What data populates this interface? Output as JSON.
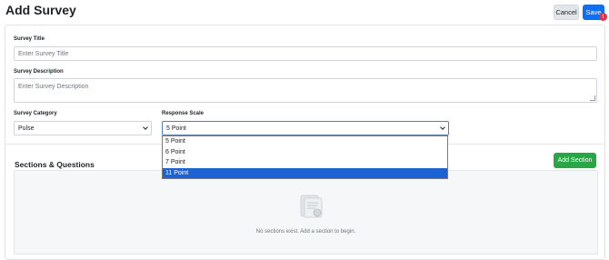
{
  "header": {
    "title": "Add Survey",
    "cancel_label": "Cancel",
    "save_label": "Save",
    "badge": "!"
  },
  "form": {
    "title_label": "Survey Title",
    "title_placeholder": "Enter Survey Title",
    "description_label": "Survey Description",
    "description_placeholder": "Enter Survey Description",
    "category_label": "Survey Category",
    "category_value": "Pulse",
    "scale_label": "Response Scale",
    "scale_value": "5 Point",
    "scale_options": [
      "5 Point",
      "6 Point",
      "7 Point",
      "11 Point"
    ],
    "scale_highlighted": "11 Point"
  },
  "sections": {
    "title": "Sections & Questions",
    "add_label": "Add Section",
    "empty_text": "No sections exist. Add a section to begin."
  },
  "colors": {
    "primary": "#0d6efd",
    "success": "#28a745",
    "danger": "#dc3545",
    "highlight": "#1a63d7"
  }
}
